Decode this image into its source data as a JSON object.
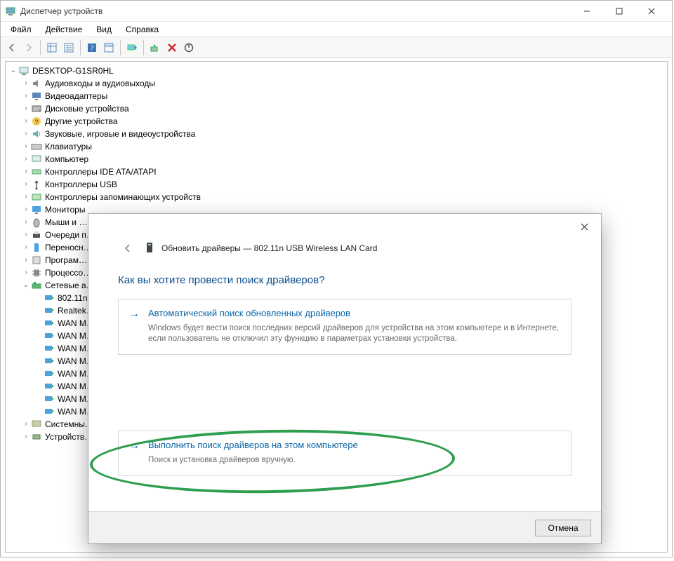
{
  "window": {
    "title": "Диспетчер устройств",
    "menu": {
      "file": "Файл",
      "action": "Действие",
      "view": "Вид",
      "help": "Справка"
    }
  },
  "tree": {
    "root": "DESKTOP-G1SR0HL",
    "items": [
      {
        "label": "Аудиовходы и аудиовыходы",
        "icon": "speaker"
      },
      {
        "label": "Видеоадаптеры",
        "icon": "display"
      },
      {
        "label": "Дисковые устройства",
        "icon": "disk"
      },
      {
        "label": "Другие устройства",
        "icon": "unknown"
      },
      {
        "label": "Звуковые, игровые и видеоустройства",
        "icon": "sound"
      },
      {
        "label": "Клавиатуры",
        "icon": "keyboard"
      },
      {
        "label": "Компьютер",
        "icon": "computer"
      },
      {
        "label": "Контроллеры IDE ATA/ATAPI",
        "icon": "ide"
      },
      {
        "label": "Контроллеры USB",
        "icon": "usb"
      },
      {
        "label": "Контроллеры запоминающих устройств",
        "icon": "storage"
      },
      {
        "label": "Мониторы",
        "icon": "monitor"
      },
      {
        "label": "Мыши и …",
        "icon": "mouse"
      },
      {
        "label": "Очереди п…",
        "icon": "printer"
      },
      {
        "label": "Переносн…",
        "icon": "portable"
      },
      {
        "label": "Програм…",
        "icon": "soft"
      },
      {
        "label": "Процессо…",
        "icon": "cpu"
      }
    ],
    "net": {
      "label": "Сетевые а…",
      "children": [
        {
          "label": "802.11n…"
        },
        {
          "label": "Realtek…"
        },
        {
          "label": "WAN M…"
        },
        {
          "label": "WAN M…"
        },
        {
          "label": "WAN M…"
        },
        {
          "label": "WAN M…"
        },
        {
          "label": "WAN M…"
        },
        {
          "label": "WAN M…"
        },
        {
          "label": "WAN M…"
        },
        {
          "label": "WAN M…"
        }
      ]
    },
    "tail": [
      {
        "label": "Системны…",
        "icon": "system"
      },
      {
        "label": "Устройств…",
        "icon": "hid"
      }
    ]
  },
  "dialog": {
    "header": "Обновить драйверы — 802.11n USB Wireless LAN Card",
    "question": "Как вы хотите провести поиск драйверов?",
    "opt1_title": "Автоматический поиск обновленных драйверов",
    "opt1_desc": "Windows будет вести поиск последних версий драйверов для устройства на этом компьютере и в Интернете, если пользователь не отключил эту функцию в параметрах установки устройства.",
    "opt2_title": "Выполнить поиск драйверов на этом компьютере",
    "opt2_desc": "Поиск и установка драйверов вручную.",
    "cancel": "Отмена"
  }
}
